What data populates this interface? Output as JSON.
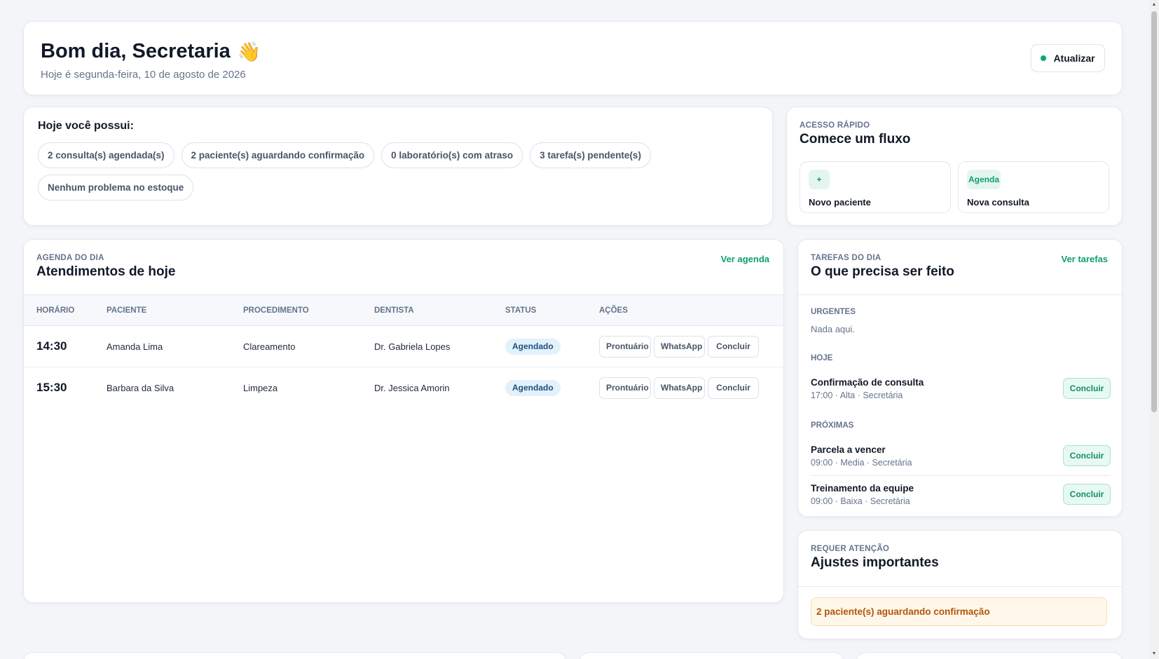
{
  "header": {
    "greeting": "Bom dia, Secretaria",
    "wave_emoji": "👋",
    "subtitle": "Hoje é segunda-feira, 10 de agosto de 2026",
    "refresh_label": "Atualizar"
  },
  "summary": {
    "title": "Hoje você possui:",
    "pills": [
      "2 consulta(s) agendada(s)",
      "2 paciente(s) aguardando confirmação",
      "0 laboratório(s) com atraso",
      "3 tarefa(s) pendente(s)",
      "Nenhum problema no estoque"
    ]
  },
  "quick_access": {
    "eyebrow": "ACESSO RÁPIDO",
    "title": "Comece um fluxo",
    "tiles": [
      {
        "icon": "+",
        "label": "Novo paciente"
      },
      {
        "icon": "Agenda",
        "label": "Nova consulta"
      }
    ]
  },
  "agenda": {
    "eyebrow": "AGENDA DO DIA",
    "title": "Atendimentos de hoje",
    "link": "Ver agenda",
    "columns": [
      "HORÁRIO",
      "PACIENTE",
      "PROCEDIMENTO",
      "DENTISTA",
      "STATUS",
      "AÇÕES"
    ],
    "rows": [
      {
        "time": "14:30",
        "patient": "Amanda Lima",
        "procedure": "Clareamento",
        "dentist": "Dr. Gabriela Lopes",
        "status": "Agendado"
      },
      {
        "time": "15:30",
        "patient": "Barbara da Silva",
        "procedure": "Limpeza",
        "dentist": "Dr. Jessica Amorin",
        "status": "Agendado"
      }
    ],
    "actions": [
      "Prontuário",
      "WhatsApp",
      "Concluir"
    ]
  },
  "tasks": {
    "eyebrow": "TAREFAS DO DIA",
    "title": "O que precisa ser feito",
    "link": "Ver tarefas",
    "urgent_label": "URGENTES",
    "urgent_empty": "Nada aqui.",
    "today_label": "HOJE",
    "today": [
      {
        "title": "Confirmação de consulta",
        "meta": "17:00 · Alta · Secretária",
        "action": "Concluir"
      }
    ],
    "next_label": "PRÓXIMAS",
    "next": [
      {
        "title": "Parcela a vencer",
        "meta": "09:00 · Media · Secretária",
        "action": "Concluir"
      },
      {
        "title": "Treinamento da equipe",
        "meta": "09:00 · Baixa · Secretária",
        "action": "Concluir"
      }
    ]
  },
  "attention": {
    "eyebrow": "REQUER ATENÇÃO",
    "title": "Ajustes importantes",
    "alert": "2 paciente(s) aguardando confirmação"
  },
  "colors": {
    "accent": "#0e9e74",
    "badge_bg": "#e3f1fb",
    "alert_bg": "#fff8ea",
    "alert_text": "#b45309"
  }
}
